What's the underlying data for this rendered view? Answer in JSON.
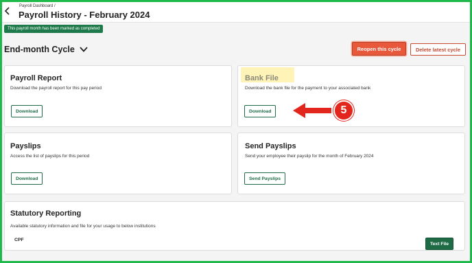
{
  "header": {
    "breadcrumb": "Payroll Dashboard /",
    "title": "Payroll History - February 2024",
    "back_icon": "chevron-left-icon"
  },
  "status_badge": "This payroll month has been marked as completed",
  "cycle": {
    "label": "End-month Cycle",
    "icon": "chevron-down-icon"
  },
  "actions": {
    "reopen": "Reopen this cycle",
    "delete": "Delete latest cycle"
  },
  "cards": {
    "payroll_report": {
      "title": "Payroll Report",
      "description": "Download the payroll report for this pay period",
      "button": "Download"
    },
    "bank_file": {
      "title": "Bank File",
      "description": "Download the bank file for the payment to your associated bank",
      "button": "Download"
    },
    "payslips": {
      "title": "Payslips",
      "description": "Access the list of payslips for this period",
      "button": "Download"
    },
    "send_payslips": {
      "title": "Send Payslips",
      "description": "Send your employee their payslip for the month of February 2024",
      "button": "Send Payslips"
    },
    "statutory": {
      "title": "Statutory Reporting",
      "description": "Available statutory information and file for your usage to below institutions",
      "institution": "CPF",
      "button": "Text File"
    }
  },
  "annotation": {
    "step_number": "5",
    "arrow_icon": "arrow-left-icon"
  },
  "colors": {
    "frame_border": "#1fb84a",
    "primary_green": "#1e6b46",
    "danger": "#e8583a",
    "highlight": "#fff3b8",
    "annotation_red": "#e3261d"
  }
}
